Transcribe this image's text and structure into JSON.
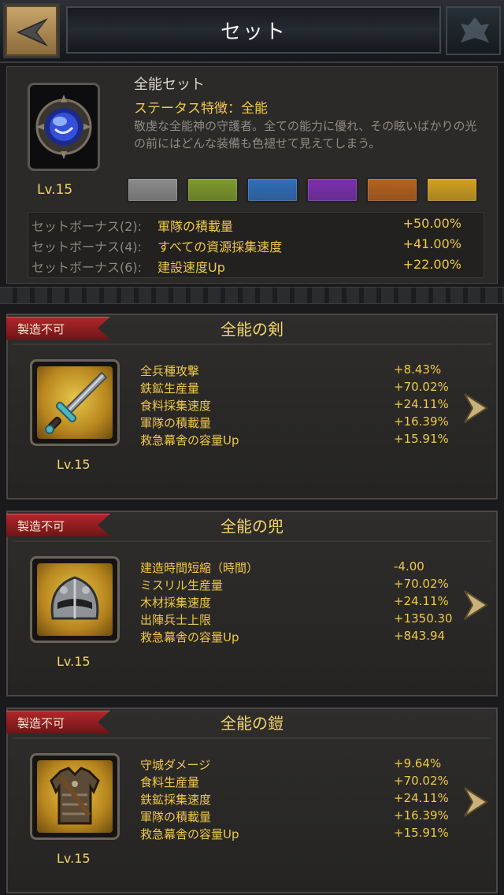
{
  "header": {
    "title": "セット",
    "back_icon": "back-arrow-icon",
    "right_icon": "emblem-icon"
  },
  "set": {
    "name": "全能セット",
    "feature": "ステータス特徴：全能",
    "description": "敬虔な全能神の守護者。全ての能力に優れ、その眩いばかりの光の前にはどんな装備も色褪せて見えてしまう。",
    "level": "Lv.15",
    "icon": "orb-emblem-icon",
    "quality_colors": [
      "#8c8c8c",
      "#7f9c2a",
      "#2f6fbd",
      "#7c2fb0",
      "#b8621c",
      "#d4a21e"
    ],
    "bonuses": [
      {
        "label": "セットボーナス(2):",
        "name": "軍隊の積載量",
        "value": "+50.00%"
      },
      {
        "label": "セットボーナス(4):",
        "name": "すべての資源採集速度",
        "value": "+41.00%"
      },
      {
        "label": "セットボーナス(6):",
        "name": "建設速度Up",
        "value": "+22.00%"
      }
    ]
  },
  "items": [
    {
      "badge": "製造不可",
      "title": "全能の剣",
      "level": "Lv.15",
      "icon": "sword-icon",
      "stats": [
        {
          "name": "全兵種攻撃",
          "value": "+8.43%"
        },
        {
          "name": "鉄鉱生産量",
          "value": "+70.02%"
        },
        {
          "name": "食料採集速度",
          "value": "+24.11%"
        },
        {
          "name": "軍隊の積載量",
          "value": "+16.39%"
        },
        {
          "name": "救急幕舎の容量Up",
          "value": "+15.91%"
        }
      ]
    },
    {
      "badge": "製造不可",
      "title": "全能の兜",
      "level": "Lv.15",
      "icon": "helmet-icon",
      "stats": [
        {
          "name": "建造時間短縮（時間）",
          "value": "-4.00"
        },
        {
          "name": "ミスリル生産量",
          "value": "+70.02%"
        },
        {
          "name": "木材採集速度",
          "value": "+24.11%"
        },
        {
          "name": "出陣兵士上限",
          "value": "+1350.30"
        },
        {
          "name": "救急幕舎の容量Up",
          "value": "+843.94"
        }
      ]
    },
    {
      "badge": "製造不可",
      "title": "全能の鎧",
      "level": "Lv.15",
      "icon": "armor-icon",
      "stats": [
        {
          "name": "守城ダメージ",
          "value": "+9.64%"
        },
        {
          "name": "食料生産量",
          "value": "+70.02%"
        },
        {
          "name": "鉄鉱採集速度",
          "value": "+24.11%"
        },
        {
          "name": "軍隊の積載量",
          "value": "+16.39%"
        },
        {
          "name": "救急幕舎の容量Up",
          "value": "+15.91%"
        }
      ]
    }
  ]
}
